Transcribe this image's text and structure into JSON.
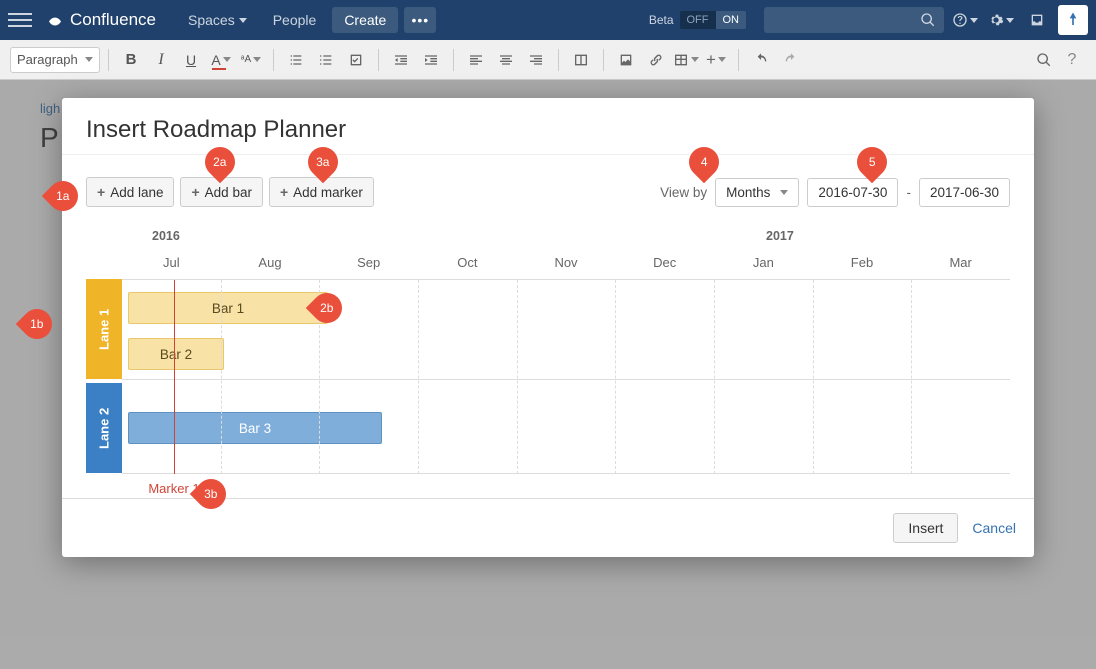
{
  "navbar": {
    "brand": "Confluence",
    "spaces": "Spaces",
    "people": "People",
    "create": "Create",
    "beta": "Beta",
    "off": "OFF",
    "on": "ON"
  },
  "editor": {
    "format_select": "Paragraph"
  },
  "page": {
    "breadcrumb": "ligh",
    "title": "P"
  },
  "modal": {
    "title": "Insert Roadmap Planner",
    "add_lane": "Add lane",
    "add_bar": "Add bar",
    "add_marker": "Add marker",
    "view_by_label": "View by",
    "view_by_value": "Months",
    "date_start": "2016-07-30",
    "date_separator": "-",
    "date_end": "2017-06-30",
    "insert": "Insert",
    "cancel": "Cancel"
  },
  "roadmap": {
    "years": [
      "2016",
      "2017"
    ],
    "months": [
      "Jul",
      "Aug",
      "Sep",
      "Oct",
      "Nov",
      "Dec",
      "Jan",
      "Feb",
      "Mar"
    ],
    "lanes": {
      "lane1": "Lane 1",
      "lane2": "Lane 2"
    },
    "bars": {
      "bar1": "Bar 1",
      "bar2": "Bar 2",
      "bar3": "Bar 3"
    },
    "marker1": "Marker 1"
  },
  "pins": {
    "p1a": "1a",
    "p2a": "2a",
    "p3a": "3a",
    "p4": "4",
    "p5": "5",
    "p1b": "1b",
    "p2b": "2b",
    "p3b": "3b"
  }
}
